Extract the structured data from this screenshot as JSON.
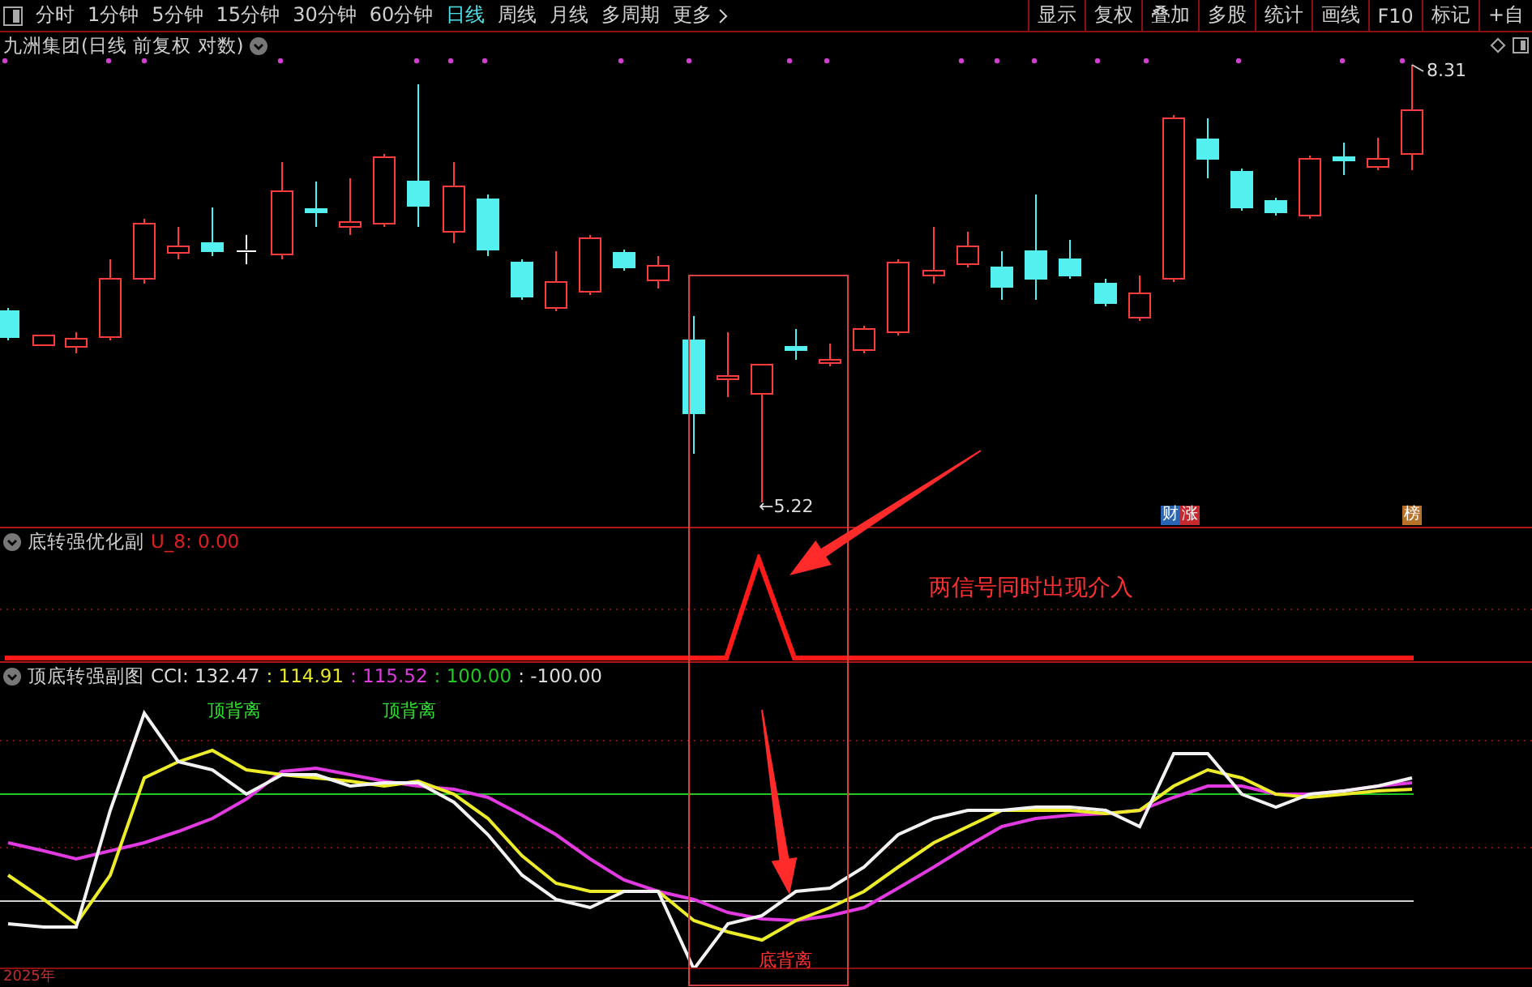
{
  "toolbar": {
    "periods": [
      {
        "label": "分时",
        "selected": false
      },
      {
        "label": "1分钟",
        "selected": false
      },
      {
        "label": "5分钟",
        "selected": false
      },
      {
        "label": "15分钟",
        "selected": false
      },
      {
        "label": "30分钟",
        "selected": false
      },
      {
        "label": "60分钟",
        "selected": false
      },
      {
        "label": "日线",
        "selected": true
      },
      {
        "label": "周线",
        "selected": false
      },
      {
        "label": "月线",
        "selected": false
      },
      {
        "label": "多周期",
        "selected": false
      },
      {
        "label": "更多",
        "selected": false
      }
    ],
    "tools": [
      "显示",
      "复权",
      "叠加",
      "多股",
      "统计",
      "画线",
      "F10",
      "标记",
      "+自"
    ]
  },
  "main_chart": {
    "title": "九洲集团(日线 前复权 对数)",
    "high_label": "8.31",
    "low_label": "←5.22",
    "badge_groups": [
      [
        {
          "text": "财",
          "color": "#2a64b4"
        },
        {
          "text": "涨",
          "color": "#c42a30"
        }
      ],
      [
        {
          "text": "榜",
          "color": "#b8732a"
        }
      ]
    ]
  },
  "signal_panel": {
    "title": "底转强优化副",
    "reading": "U_8: 0.00",
    "note": "两信号同时出现介入"
  },
  "cci_panel": {
    "title": "顶底转强副图",
    "readings": [
      {
        "text": "CCI: 132.47",
        "color": "#dcdcdc"
      },
      {
        "text": ": 114.91",
        "color": "#e6e62a"
      },
      {
        "text": ": 115.52",
        "color": "#e03ae0"
      },
      {
        "text": ": 100.00",
        "color": "#22c822"
      },
      {
        "text": ": -100.00",
        "color": "#dcdcdc"
      }
    ],
    "top_labels": [
      "顶背离",
      "顶背离"
    ],
    "bottom_label": "底背离"
  },
  "axis": {
    "year": "2025年"
  }
}
